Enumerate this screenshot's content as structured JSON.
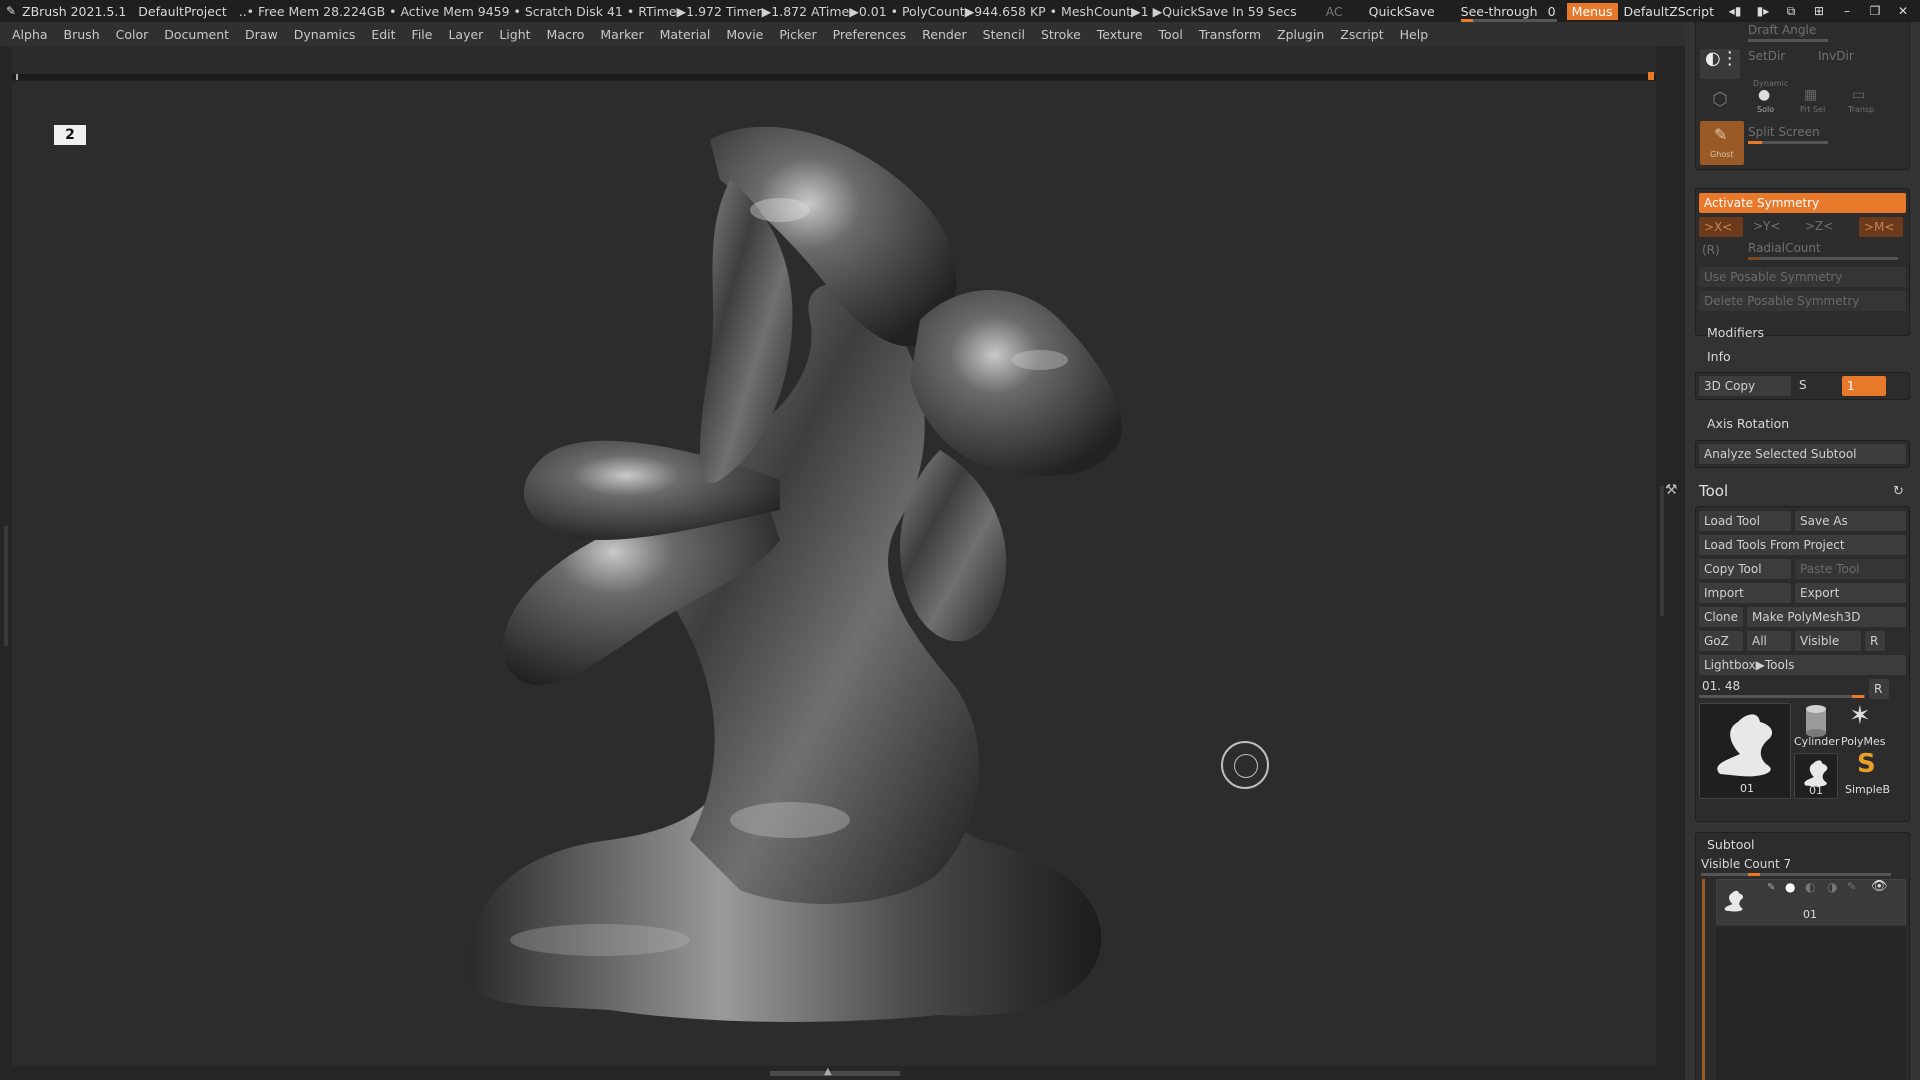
{
  "titlebar": {
    "app": "ZBrush 2021.5.1",
    "project": "DefaultProject",
    "status": "..• Free Mem 28.224GB • Active Mem 9459 • Scratch Disk 41 •  RTime▶1.972 Timer▶1.872 ATime▶0.01 • PolyCount▶944.658 KP  • MeshCount▶1  ▶QuickSave In 59 Secs",
    "ac": "AC",
    "quicksave": "QuickSave",
    "see_through_label": "See-through",
    "see_through_value": "0",
    "menus": "Menus",
    "script": "DefaultZScript",
    "accent": "#e8792b"
  },
  "menubar": {
    "items": [
      "Alpha",
      "Brush",
      "Color",
      "Document",
      "Draw",
      "Dynamics",
      "Edit",
      "File",
      "Layer",
      "Light",
      "Macro",
      "Marker",
      "Material",
      "Movie",
      "Picker",
      "Preferences",
      "Render",
      "Stencil",
      "Stroke",
      "Texture",
      "Tool",
      "Transform",
      "Zplugin",
      "Zscript",
      "Help"
    ]
  },
  "canvas": {
    "nav_badge": "2",
    "cursor_icon": "brush-cursor-ring-icon"
  },
  "palette": {
    "draw": {
      "draft_angle": "Draft Angle",
      "setdir": "SetDir",
      "invdir": "InvDir",
      "dynamic": "Dynamic",
      "solo": "Solo",
      "frt_sel": "Frt Sel",
      "transp": "Transp",
      "ghost": "Ghost",
      "split_screen": "Split Screen"
    },
    "symmetry": {
      "activate": "Activate Symmetry",
      "x": ">X<",
      "y": ">Y<",
      "z": ">Z<",
      "m": ">M<",
      "r": "(R)",
      "radial_count": "RadialCount",
      "use_posable": "Use Posable Symmetry",
      "delete_posable": "Delete Posable Symmetry"
    },
    "modifiers": "Modifiers",
    "info": "Info",
    "copy3d": {
      "label": "3D Copy",
      "s": "S",
      "value": "1"
    },
    "axis_rotation": "Axis Rotation",
    "analyze": "Analyze Selected Subtool",
    "tool": {
      "title": "Tool",
      "load_tool": "Load Tool",
      "save_as": "Save As",
      "load_from_project": "Load Tools From Project",
      "copy_tool": "Copy Tool",
      "paste_tool": "Paste Tool",
      "import": "Import",
      "export": "Export",
      "clone": "Clone",
      "make_polymesh": "Make PolyMesh3D",
      "goz": "GoZ",
      "all": "All",
      "visible": "Visible",
      "r": "R",
      "lightbox_tools": "Lightbox▶Tools",
      "current": "01. 48",
      "current_r": "R",
      "tiles": [
        {
          "caption": "01"
        },
        {
          "caption": "Cylinder"
        },
        {
          "caption": "PolyMes"
        },
        {
          "caption": "01"
        },
        {
          "caption": "SimpleB"
        }
      ]
    },
    "subtool": {
      "title": "Subtool",
      "visible_count": "Visible Count 7",
      "item_name": "01"
    }
  }
}
